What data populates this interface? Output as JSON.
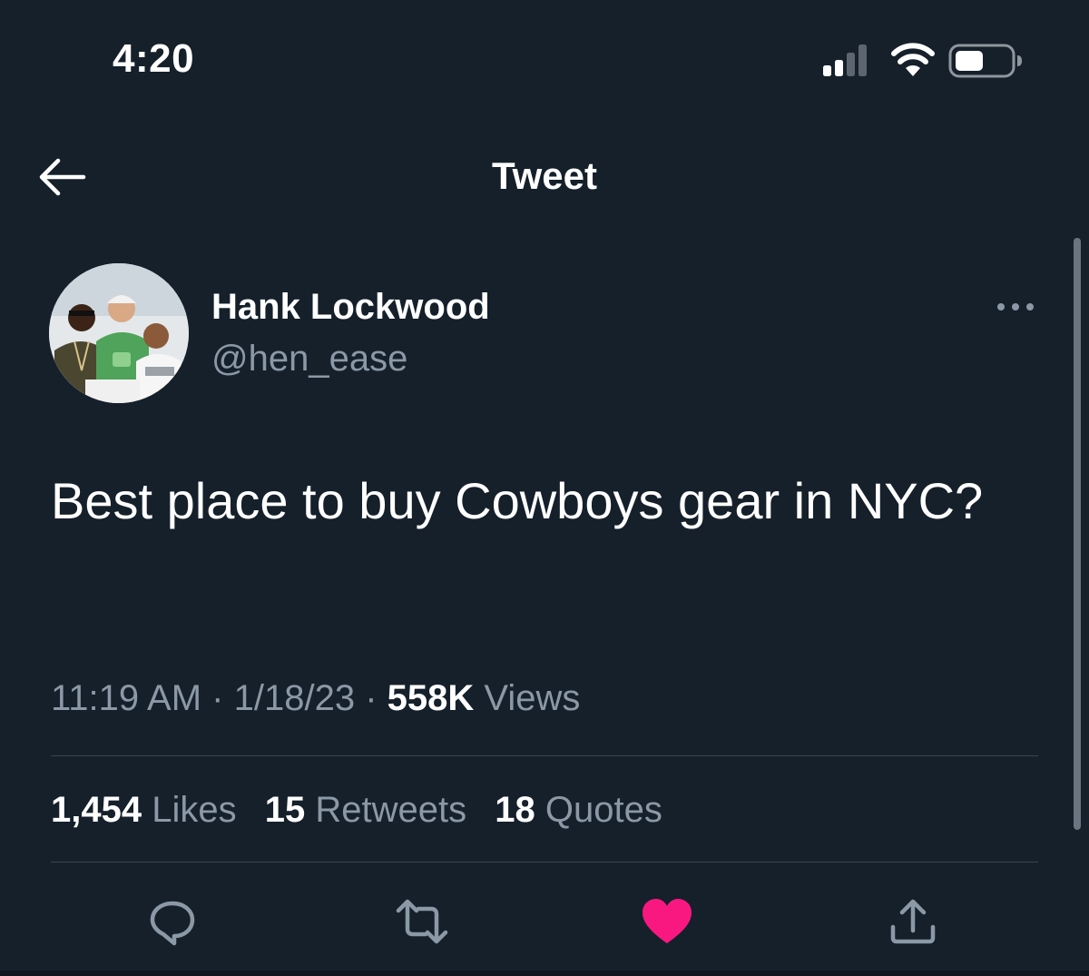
{
  "status_bar": {
    "time": "4:20"
  },
  "nav": {
    "title": "Tweet"
  },
  "tweet": {
    "display_name": "Hank Lockwood",
    "username": "@hen_ease",
    "text": "Best place to buy Cowboys gear in NYC?",
    "time": "11:19 AM",
    "date": "1/18/23",
    "views_count": "558K",
    "views_label": "Views",
    "separator": "·",
    "stats": {
      "likes_count": "1,454",
      "likes_label": "Likes",
      "retweets_count": "15",
      "retweets_label": "Retweets",
      "quotes_count": "18",
      "quotes_label": "Quotes"
    },
    "liked": true
  },
  "colors": {
    "background": "#15202b",
    "primary_text": "#ffffff",
    "secondary_text": "#8b98a5",
    "divider": "#38444d",
    "like_active": "#f91880"
  },
  "icons": {
    "back": "arrow-left-icon",
    "more": "more-horizontal-icon",
    "reply": "reply-icon",
    "retweet": "retweet-icon",
    "like": "heart-filled-icon",
    "share": "share-icon"
  }
}
